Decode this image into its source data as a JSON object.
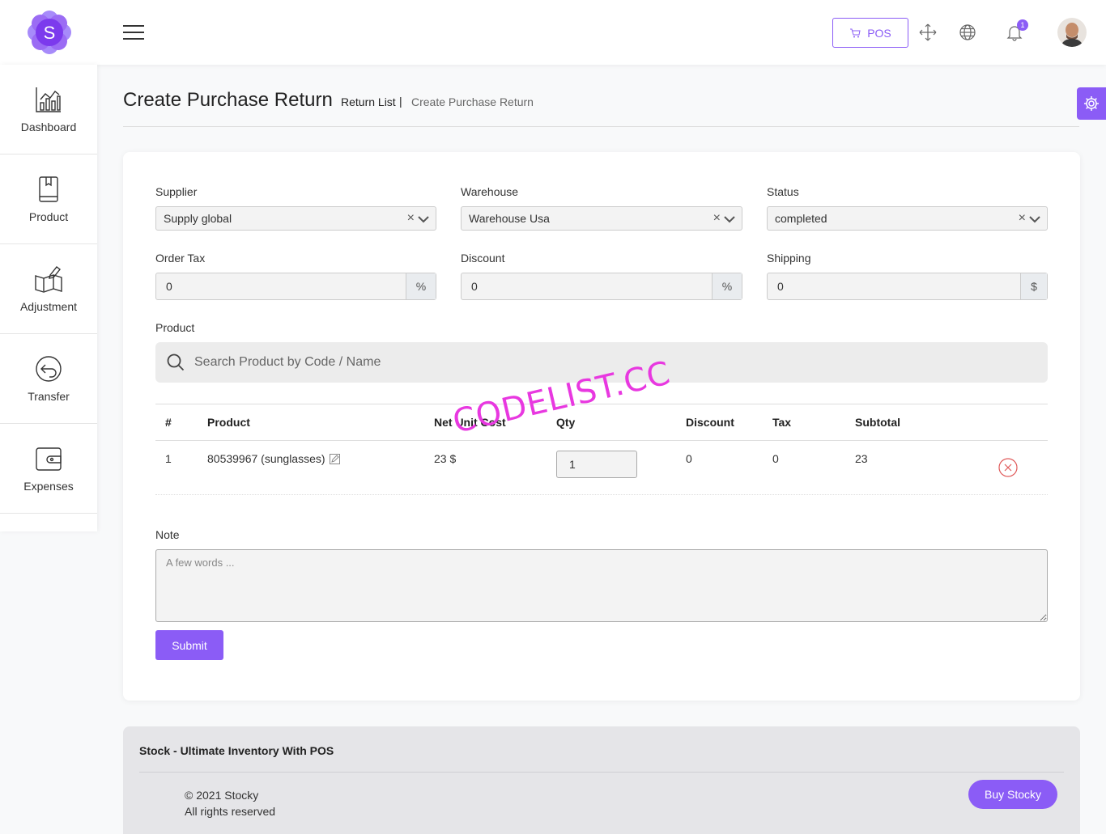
{
  "header": {
    "logo_letter": "S",
    "pos_label": "POS",
    "notification_count": "1"
  },
  "sidebar": {
    "items": [
      {
        "label": "Dashboard"
      },
      {
        "label": "Product"
      },
      {
        "label": "Adjustment"
      },
      {
        "label": "Transfer"
      },
      {
        "label": "Expenses"
      }
    ]
  },
  "page": {
    "title": "Create Purchase Return",
    "breadcrumb_parent": "Return List",
    "breadcrumb_sep": "|",
    "breadcrumb_current": "Create Purchase Return"
  },
  "form": {
    "supplier_label": "Supplier",
    "supplier_value": "Supply global",
    "warehouse_label": "Warehouse",
    "warehouse_value": "Warehouse Usa",
    "status_label": "Status",
    "status_value": "completed",
    "order_tax_label": "Order Tax",
    "order_tax_value": "0",
    "order_tax_unit": "%",
    "discount_label": "Discount",
    "discount_value": "0",
    "discount_unit": "%",
    "shipping_label": "Shipping",
    "shipping_value": "0",
    "shipping_unit": "$",
    "product_label": "Product",
    "search_placeholder": "Search Product by Code / Name",
    "note_label": "Note",
    "note_placeholder": "A few words ...",
    "submit_label": "Submit"
  },
  "table": {
    "headers": [
      "#",
      "Product",
      "Net Unit Cost",
      "Qty",
      "Discount",
      "Tax",
      "Subtotal"
    ],
    "rows": [
      {
        "num": "1",
        "product": "80539967 (sunglasses)",
        "net_unit_cost": "23 $",
        "qty": "1",
        "discount": "0",
        "tax": "0",
        "subtotal": "23"
      }
    ]
  },
  "watermark": "CODELIST.CC",
  "footer": {
    "title": "Stock - Ultimate Inventory With POS",
    "copyright": "© 2021 Stocky",
    "rights": "All rights reserved",
    "buy_label": "Buy Stocky"
  },
  "colors": {
    "accent": "#8b5cf6",
    "danger": "#e05a5a"
  }
}
